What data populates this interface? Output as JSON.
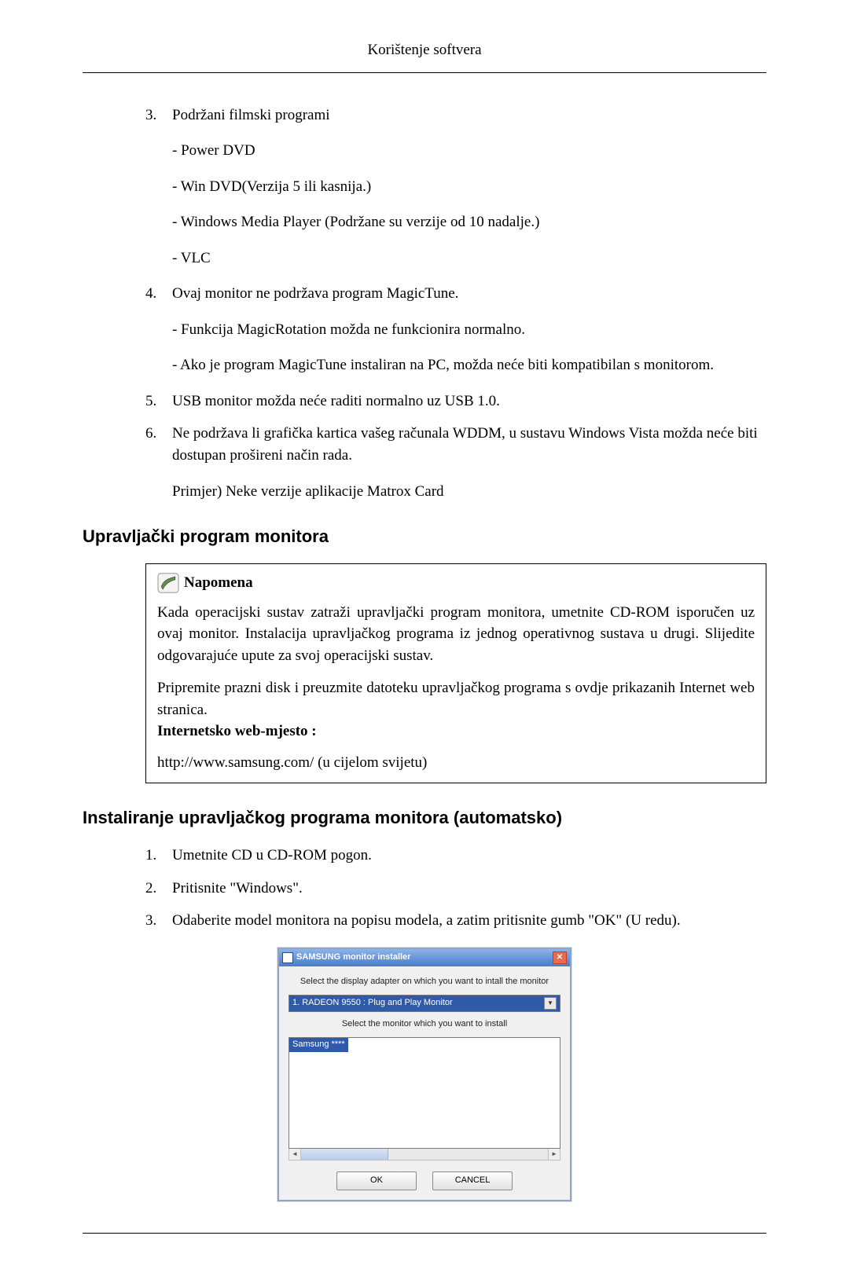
{
  "header_title": "Korištenje softvera",
  "top_list": {
    "item3": {
      "num": "3.",
      "title": "Podržani filmski programi",
      "subs": [
        "- Power DVD",
        "- Win DVD(Verzija 5 ili kasnija.)",
        "- Windows Media Player (Podržane su verzije od 10 nadalje.)",
        "- VLC"
      ]
    },
    "item4": {
      "num": "4.",
      "title": "Ovaj monitor ne podržava program MagicTune.",
      "subs": [
        "- Funkcija MagicRotation možda ne funkcionira normalno.",
        "- Ako je program MagicTune instaliran na PC, možda neće biti kompatibilan s monitorom."
      ]
    },
    "item5": {
      "num": "5.",
      "text": "USB monitor možda neće raditi normalno uz USB 1.0."
    },
    "item6": {
      "num": "6.",
      "text": "Ne podržava li grafička kartica vašeg računala WDDM, u sustavu Windows Vista možda neće biti dostupan prošireni način rada.",
      "example": "Primjer) Neke verzije aplikacije Matrox Card"
    }
  },
  "section1_title": "Upravljački program monitora",
  "note": {
    "title": "Napomena",
    "p1": "Kada operacijski sustav zatraži upravljački program monitora, umetnite CD-ROM isporučen uz ovaj monitor. Instalacija upravljačkog programa iz jednog operativnog sustava u drugi. Slijedite odgovarajuće upute za svoj operacijski sustav.",
    "p2": "Pripremite prazni disk i preuzmite datoteku upravljačkog programa s ovdje prikazanih Internet web stranica.",
    "website_label": "Internetsko web-mjesto :",
    "url": "http://www.samsung.com/ (u cijelom svijetu)"
  },
  "section2_title": "Instaliranje upravljačkog programa monitora (automatsko)",
  "install_steps": {
    "s1": {
      "num": "1.",
      "text": "Umetnite CD u CD-ROM pogon."
    },
    "s2": {
      "num": "2.",
      "text": "Pritisnite \"Windows\"."
    },
    "s3": {
      "num": "3.",
      "text": "Odaberite model monitora na popisu modela, a zatim pritisnite gumb \"OK\" (U redu)."
    }
  },
  "dialog": {
    "title": "SAMSUNG monitor installer",
    "label1": "Select the display adapter on which you want to intall the monitor",
    "adapter": "1. RADEON 9550 : Plug and Play Monitor",
    "label2": "Select the monitor which you want to install",
    "selected_monitor": "Samsung ****",
    "ok": "OK",
    "cancel": "CANCEL"
  }
}
